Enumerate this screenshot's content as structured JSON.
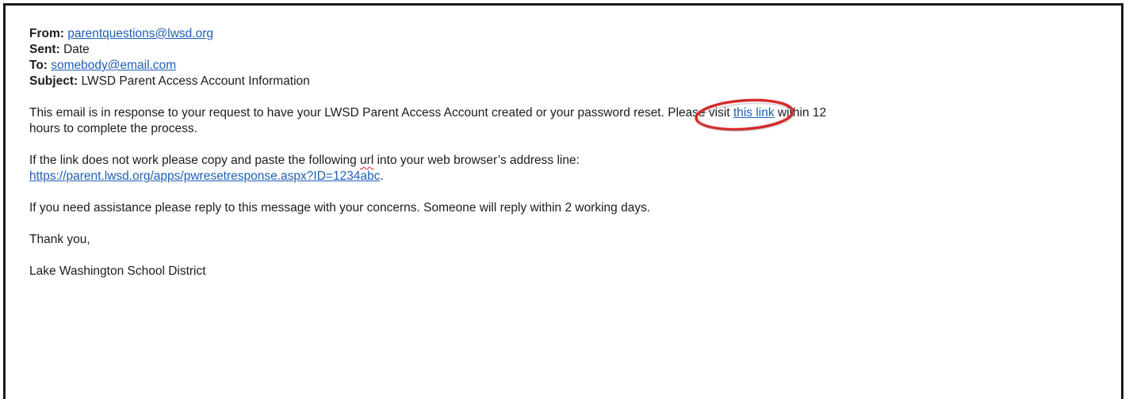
{
  "email": {
    "from_label": "From:",
    "from_value": "parentquestions@lwsd.org",
    "sent_label": "Sent:",
    "sent_value": "Date",
    "to_label": "To:",
    "to_value": "somebody@email.com",
    "subject_label": "Subject:",
    "subject_value": "LWSD Parent Access Account Information"
  },
  "body": {
    "p1_before": "This email is in response to your request to have your LWSD Parent Access Account created or your password reset.  Please visit ",
    "p1_link": "this link",
    "p1_after_line1": " within 12",
    "p1_line2": "hours to complete the process.",
    "p2_before": "If the link does not work please copy and paste the following ",
    "p2_url_word": "url",
    "p2_after": " into your web browser’s address line:",
    "p2_link": "https://parent.lwsd.org/apps/pwresetresponse.aspx?ID=1234abc",
    "p2_end": ".",
    "p3": "If you need assistance please reply to this message with your concerns.  Someone will reply within 2 working days.",
    "p4": "Thank you,",
    "p5": "Lake Washington School District"
  },
  "colors": {
    "link": "#1f5fb5",
    "highlight_circle": "#d62a2a"
  },
  "icons": {
    "annotation": "red-ellipse-highlight"
  }
}
